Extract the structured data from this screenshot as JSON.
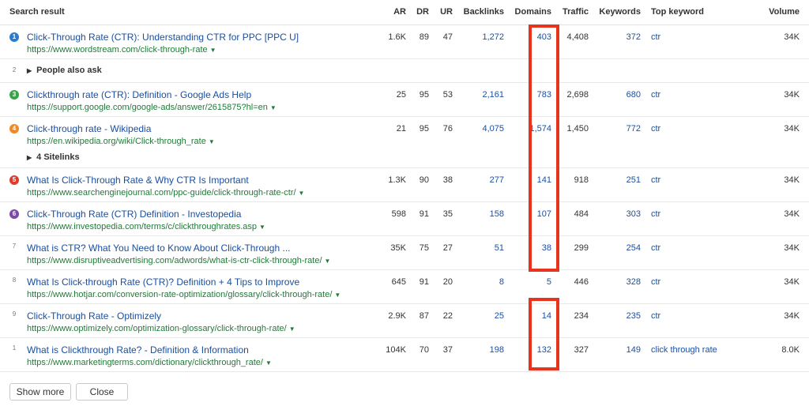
{
  "headers": {
    "search_result": "Search result",
    "ar": "AR",
    "dr": "DR",
    "ur": "UR",
    "backlinks": "Backlinks",
    "domains": "Domains",
    "traffic": "Traffic",
    "keywords": "Keywords",
    "top_keyword": "Top keyword",
    "volume": "Volume"
  },
  "rows": [
    {
      "rank": "1",
      "rank_color": "#2b7bd1",
      "title": "Click-Through Rate (CTR): Understanding CTR for PPC [PPC U]",
      "url": "https://www.wordstream.com/click-through-rate",
      "ar": "1.6K",
      "dr": "89",
      "ur": "47",
      "backlinks": "1,272",
      "domains": "403",
      "traffic": "4,408",
      "keywords": "372",
      "top_keyword": "ctr",
      "volume": "34K"
    },
    {
      "rank": "3",
      "rank_color": "#3aa34a",
      "title": "Clickthrough rate (CTR): Definition - Google Ads Help",
      "url": "https://support.google.com/google-ads/answer/2615875?hl=en",
      "ar": "25",
      "dr": "95",
      "ur": "53",
      "backlinks": "2,161",
      "domains": "783",
      "traffic": "2,698",
      "keywords": "680",
      "top_keyword": "ctr",
      "volume": "34K"
    },
    {
      "rank": "4",
      "rank_color": "#f08a24",
      "title": "Click-through rate - Wikipedia",
      "url": "https://en.wikipedia.org/wiki/Click-through_rate",
      "ar": "21",
      "dr": "95",
      "ur": "76",
      "backlinks": "4,075",
      "domains": "1,574",
      "traffic": "1,450",
      "keywords": "772",
      "top_keyword": "ctr",
      "volume": "34K"
    },
    {
      "rank": "5",
      "rank_color": "#e03a2f",
      "title": "What Is Click-Through Rate & Why CTR Is Important",
      "url": "https://www.searchenginejournal.com/ppc-guide/click-through-rate-ctr/",
      "ar": "1.3K",
      "dr": "90",
      "ur": "38",
      "backlinks": "277",
      "domains": "141",
      "traffic": "918",
      "keywords": "251",
      "top_keyword": "ctr",
      "volume": "34K"
    },
    {
      "rank": "6",
      "rank_color": "#7b4aa8",
      "title": "Click-Through Rate (CTR) Definition - Investopedia",
      "url": "https://www.investopedia.com/terms/c/clickthroughrates.asp",
      "ar": "598",
      "dr": "91",
      "ur": "35",
      "backlinks": "158",
      "domains": "107",
      "traffic": "484",
      "keywords": "303",
      "top_keyword": "ctr",
      "volume": "34K"
    },
    {
      "rank": "7",
      "rank_color": "",
      "title": "What is CTR? What You Need to Know About Click-Through ...",
      "url": "https://www.disruptiveadvertising.com/adwords/what-is-ctr-click-through-rate/",
      "ar": "35K",
      "dr": "75",
      "ur": "27",
      "backlinks": "51",
      "domains": "38",
      "traffic": "299",
      "keywords": "254",
      "top_keyword": "ctr",
      "volume": "34K"
    },
    {
      "rank": "8",
      "rank_color": "",
      "title": "What Is Click-through Rate (CTR)? Definition + 4 Tips to Improve",
      "url": "https://www.hotjar.com/conversion-rate-optimization/glossary/click-through-rate/",
      "ar": "645",
      "dr": "91",
      "ur": "20",
      "backlinks": "8",
      "domains": "5",
      "traffic": "446",
      "keywords": "328",
      "top_keyword": "ctr",
      "volume": "34K"
    },
    {
      "rank": "9",
      "rank_color": "",
      "title": "Click-Through Rate - Optimizely",
      "url": "https://www.optimizely.com/optimization-glossary/click-through-rate/",
      "ar": "2.9K",
      "dr": "87",
      "ur": "22",
      "backlinks": "25",
      "domains": "14",
      "traffic": "234",
      "keywords": "235",
      "top_keyword": "ctr",
      "volume": "34K"
    },
    {
      "rank": "1",
      "rank_color": "",
      "title": "What is Clickthrough Rate? - Definition & Information",
      "url": "https://www.marketingterms.com/dictionary/clickthrough_rate/",
      "ar": "104K",
      "dr": "70",
      "ur": "37",
      "backlinks": "198",
      "domains": "132",
      "traffic": "327",
      "keywords": "149",
      "top_keyword": "click through rate",
      "volume": "8.0K"
    }
  ],
  "people_also_ask": {
    "rank": "2",
    "label": "People also ask"
  },
  "sitelinks": {
    "label": "4 Sitelinks"
  },
  "buttons": {
    "show_more": "Show more",
    "close": "Close"
  },
  "colors": {
    "highlight": "#e8341c",
    "link": "#1a4fa0",
    "url": "#217a3a"
  }
}
